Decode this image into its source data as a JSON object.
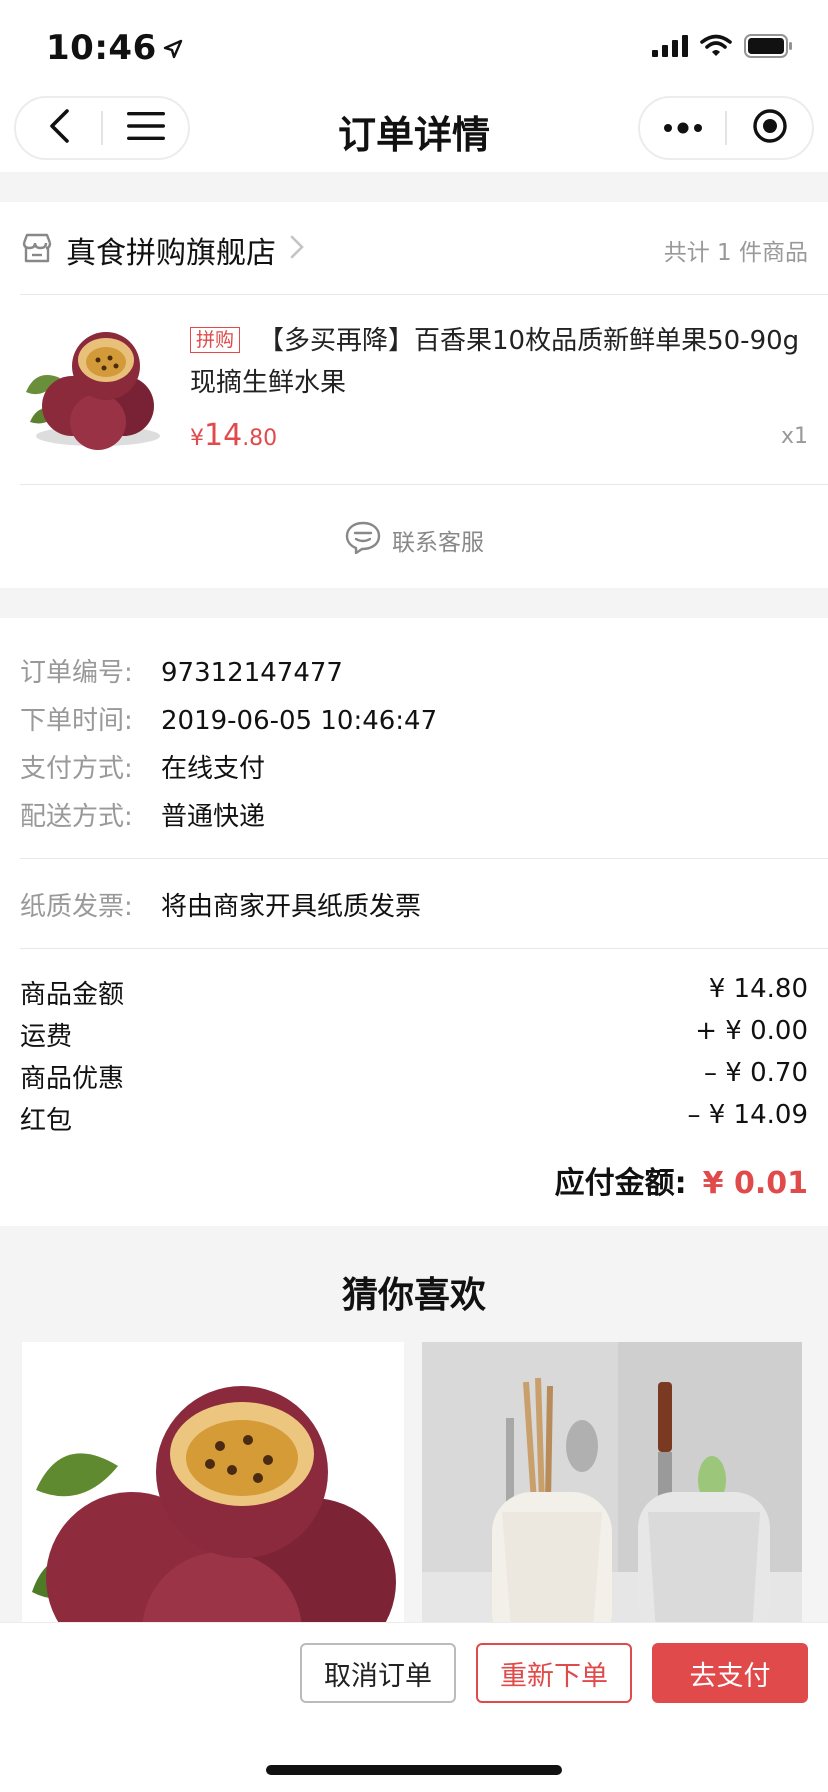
{
  "status_bar": {
    "time": "10:46",
    "location_icon": "location-arrow-icon",
    "signal_icon": "cellular-signal-icon",
    "wifi_icon": "wifi-icon",
    "battery_icon": "battery-icon"
  },
  "nav": {
    "title": "订单详情",
    "back_icon": "back-chevron-icon",
    "menu_icon": "hamburger-menu-icon",
    "more_icon": "more-dots-icon",
    "target_icon": "close-target-icon"
  },
  "store": {
    "name": "真食拼购旗舰店",
    "count_text": "共计 1 件商品",
    "icon": "store-icon"
  },
  "product": {
    "tag": "拼购",
    "title": "【多买再降】百香果10枚品质新鲜单果50-90g 现摘生鲜水果",
    "price_symbol": "¥",
    "price_int": "14",
    "price_dec": ".80",
    "quantity": "x1"
  },
  "service": {
    "label": "联系客服",
    "icon": "customer-service-icon"
  },
  "order_info": {
    "order_no_label": "订单编号:",
    "order_no": "97312147477",
    "order_time_label": "下单时间:",
    "order_time": "2019-06-05 10:46:47",
    "payment_label": "支付方式:",
    "payment": "在线支付",
    "delivery_label": "配送方式:",
    "delivery": "普通快递",
    "invoice_label": "纸质发票:",
    "invoice": "将由商家开具纸质发票"
  },
  "fees": [
    {
      "label": "商品金额",
      "value": "¥ 14.80"
    },
    {
      "label": "运费",
      "value": "+ ¥ 0.00"
    },
    {
      "label": "商品优惠",
      "value": "– ¥ 0.70"
    },
    {
      "label": "红包",
      "value": "– ¥ 14.09"
    }
  ],
  "payable": {
    "label": "应付金额:",
    "amount": "¥ 0.01"
  },
  "recommend": {
    "title": "猜你喜欢"
  },
  "actions": {
    "cancel": "取消订单",
    "reorder": "重新下单",
    "pay": "去支付"
  },
  "colors": {
    "accent": "#e04a4a",
    "muted": "#999999",
    "page_bg": "#f4f4f4"
  }
}
